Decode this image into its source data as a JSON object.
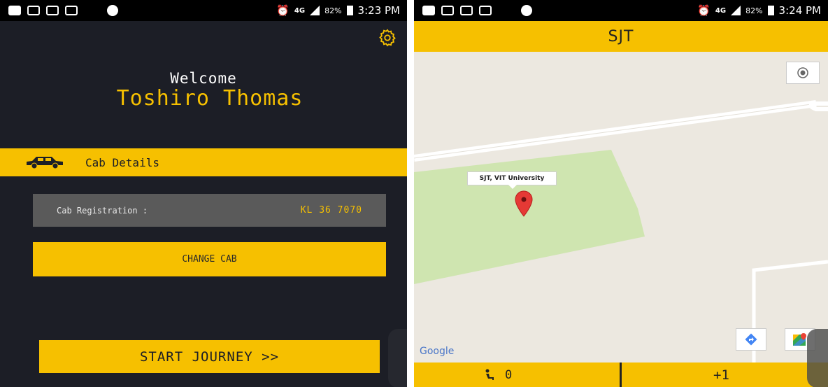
{
  "left_screen": {
    "status": {
      "network": "4G",
      "battery": "82%",
      "time": "3:23 PM"
    },
    "welcome_label": "Welcome",
    "user_name": "Toshiro Thomas",
    "cab_section_label": "Cab Details",
    "registration_label": "Cab Registration :",
    "registration_value": "KL 36 7070",
    "change_cab_label": "CHANGE CAB",
    "start_journey_label": "START JOURNEY >>"
  },
  "right_screen": {
    "status": {
      "network": "4G",
      "battery": "82%",
      "time": "3:24 PM"
    },
    "title": "SJT",
    "map": {
      "marker_label": "SJT, VIT University",
      "attribution": "Google"
    },
    "bottom": {
      "passenger_count": "0",
      "increment_label": "+1"
    }
  },
  "colors": {
    "accent": "#f6c000",
    "dark_background": "#1c1e26",
    "panel_gray": "#5a5a5a",
    "map_park": "#cfe5b0",
    "map_road": "#ffffff"
  },
  "icons": {
    "settings": "gear-icon",
    "cab": "car-icon",
    "my_location": "target-icon",
    "directions": "directions-icon",
    "maps": "maps-icon",
    "passenger": "seat-icon",
    "marker": "map-pin-icon"
  }
}
